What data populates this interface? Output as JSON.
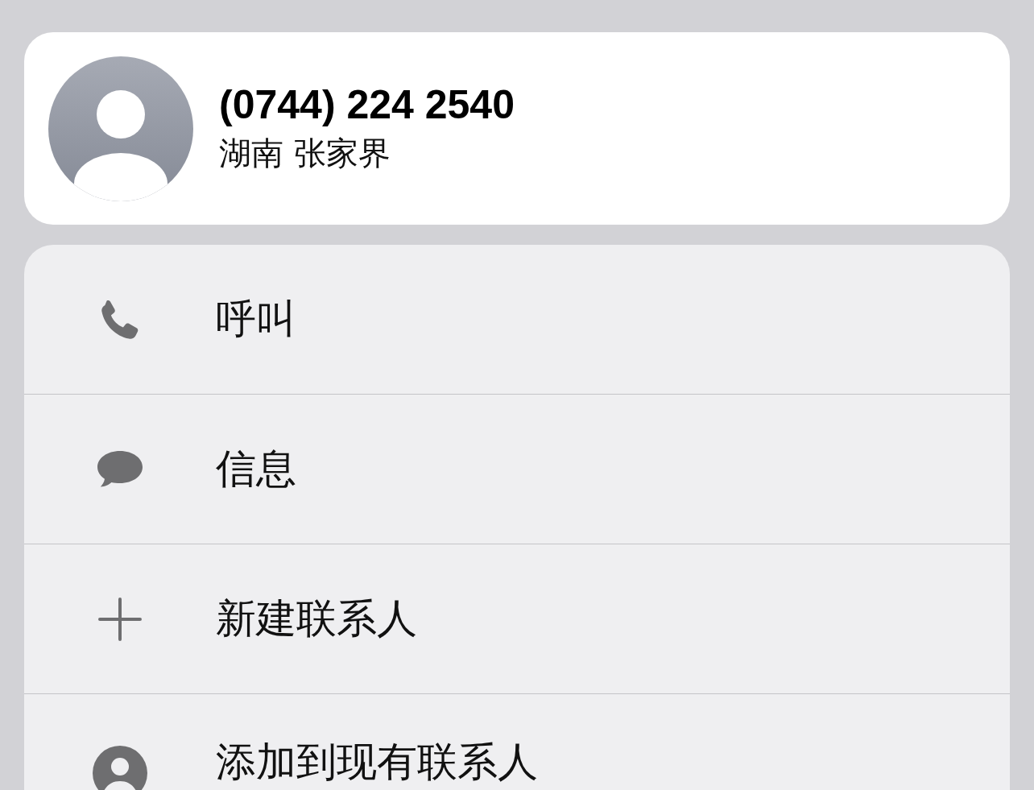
{
  "contact": {
    "phone": "(0744) 224 2540",
    "location": "湖南 张家界"
  },
  "actions": [
    {
      "label": "呼叫"
    },
    {
      "label": "信息"
    },
    {
      "label": "新建联系人"
    },
    {
      "label": "添加到现有联系人"
    }
  ]
}
